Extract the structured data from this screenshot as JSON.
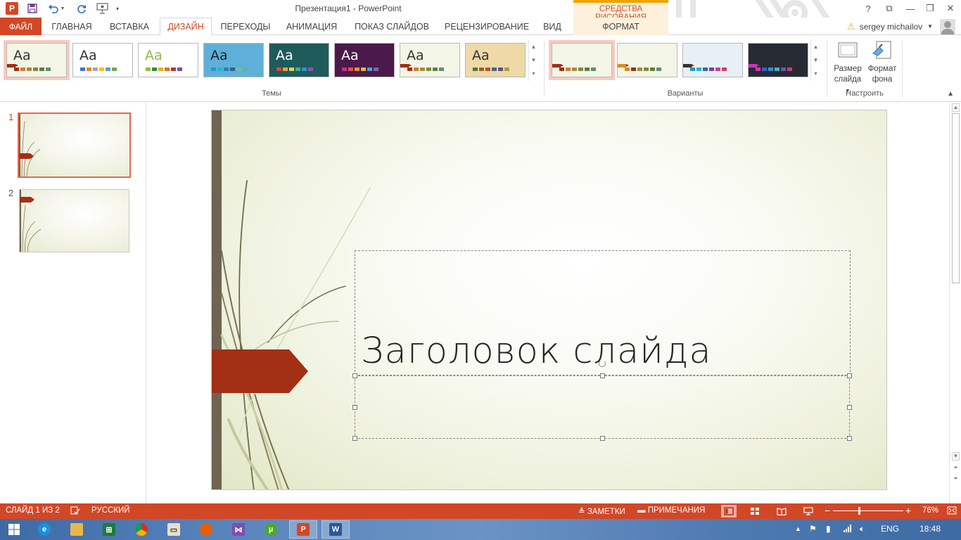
{
  "window": {
    "title": "Презентация1 - PowerPoint",
    "contextual_tools_header": "СРЕДСТВА РИСОВАНИЯ",
    "app_logo_letter": "P",
    "controls": [
      "?",
      "⧉",
      "—",
      "❐",
      "✕"
    ]
  },
  "tabs": [
    {
      "label": "ФАЙЛ",
      "state": "file"
    },
    {
      "label": "ГЛАВНАЯ"
    },
    {
      "label": "ВСТАВКА"
    },
    {
      "label": "ДИЗАЙН",
      "state": "active"
    },
    {
      "label": "ПЕРЕХОДЫ"
    },
    {
      "label": "АНИМАЦИЯ"
    },
    {
      "label": "ПОКАЗ СЛАЙДОВ"
    },
    {
      "label": "РЕЦЕНЗИРОВАНИЕ"
    },
    {
      "label": "ВИД"
    },
    {
      "label": "ФОРМАТ",
      "state": "contextual"
    }
  ],
  "user": {
    "name": "sergey michailov"
  },
  "ribbon": {
    "themes_label": "Темы",
    "variants_label": "Варианты",
    "customize_label": "Настроить",
    "themes": [
      {
        "aa": "Aa",
        "selected": true,
        "bg": "#f3f5e6",
        "fg": "#333333",
        "swatches": [
          "#a32f14",
          "#d27d2a",
          "#a58b3e",
          "#7e8a3f",
          "#607f3b",
          "#5b8f76"
        ]
      },
      {
        "aa": "Aa",
        "bg": "#ffffff",
        "fg": "#333333",
        "swatches": [
          "#4472c4",
          "#ed7d31",
          "#a5a5a5",
          "#ffc000",
          "#5b9bd5",
          "#70ad47"
        ]
      },
      {
        "aa": "Aa",
        "bg": "#ffffff",
        "fg": "#8cbf3f",
        "swatches": [
          "#8cbf3f",
          "#2f8f3a",
          "#e0b020",
          "#e07020",
          "#c03030",
          "#7f4f9f"
        ]
      },
      {
        "aa": "Aa",
        "bg": "#5fb0d8",
        "fg": "#222222",
        "swatches": [
          "#1a9ad6",
          "#26b6c4",
          "#2c7fb8",
          "#3b5998",
          "#66c2a5",
          "#5ab4ac"
        ]
      },
      {
        "aa": "Aa",
        "bg": "#1f5b5b",
        "fg": "#ffffff",
        "swatches": [
          "#e0443c",
          "#f0a030",
          "#f0d040",
          "#40b080",
          "#3090d0",
          "#9050b0"
        ]
      },
      {
        "aa": "Aa",
        "bg": "#4b1a4a",
        "fg": "#ffffff",
        "swatches": [
          "#c0308a",
          "#e05050",
          "#f09030",
          "#d0c040",
          "#50a0d0",
          "#8060c0"
        ]
      },
      {
        "aa": "Aa",
        "bg": "#f3f5e6",
        "fg": "#333333",
        "swatches": [
          "#a32f14",
          "#d27d2a",
          "#a58b3e",
          "#7e8a3f",
          "#607f3b",
          "#5b8f76"
        ]
      },
      {
        "aa": "Aa",
        "bg": "#f0d9a8",
        "fg": "#333333",
        "swatches": [
          "#4a7a3a",
          "#8a6a2a",
          "#c0502a",
          "#3a6a8a",
          "#6a4a8a",
          "#a0a040"
        ]
      }
    ],
    "variants": [
      {
        "selected": true,
        "bg": "#f3f5e6",
        "flag": "#a32f14",
        "swatches": [
          "#a32f14",
          "#d27d2a",
          "#a58b3e",
          "#7e8a3f",
          "#607f3b",
          "#5b8f76"
        ]
      },
      {
        "bg": "#f3f5e6",
        "flag": "#e08a1e",
        "swatches": [
          "#e08a1e",
          "#a32f14",
          "#a58b3e",
          "#7e8a3f",
          "#607f3b",
          "#5b8f76"
        ]
      },
      {
        "bg": "#e9f0f5",
        "flag": "#333333",
        "swatches": [
          "#2a8fd0",
          "#2ab0c0",
          "#3a60b0",
          "#8040a0",
          "#c040a0",
          "#d04060"
        ]
      },
      {
        "bg": "#262b33",
        "flag": "#d030c0",
        "swatches": [
          "#d030c0",
          "#3060d0",
          "#3090e0",
          "#40b0c0",
          "#7050c0",
          "#c04080"
        ]
      }
    ],
    "slide_size": "Размер слайда",
    "slide_size_lines": [
      "Размер",
      "слайда"
    ],
    "format_bg_lines": [
      "Формат",
      "фона"
    ]
  },
  "slides": [
    {
      "number": "1",
      "active": true
    },
    {
      "number": "2",
      "active": false
    }
  ],
  "slide": {
    "title": "Заголовок слайда"
  },
  "status": {
    "slide_info": "СЛАЙД 1 ИЗ 2",
    "language": "РУССКИЙ",
    "notes": "ЗАМЕТКИ",
    "comments": "ПРИМЕЧАНИЯ",
    "zoom": "76%"
  },
  "taskbar": {
    "lang": "ENG",
    "time": "18:48"
  },
  "colors": {
    "accent": "#d24726",
    "slide_flag": "#a32f14",
    "slide_bar": "#6f6451",
    "tools_header": "#f0a300"
  }
}
